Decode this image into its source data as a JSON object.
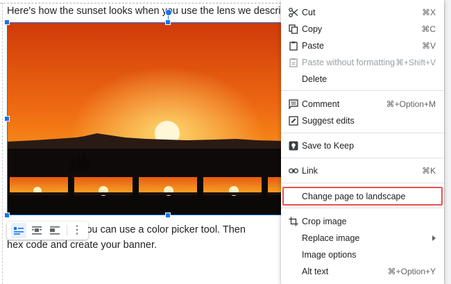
{
  "document": {
    "paragraph_top": "Here's how the sunset looks when you use the lens we described:",
    "paragraph_bottom_line1": "To                 of the image, you can use a color picker tool. Then",
    "paragraph_bottom_line2": "hex code and create your banner."
  },
  "image_toolbar": {
    "buttons": [
      {
        "name": "inline",
        "icon": "wrap-inline-icon",
        "active": true
      },
      {
        "name": "wrap-text",
        "icon": "wrap-text-icon",
        "active": false
      },
      {
        "name": "break-text",
        "icon": "break-text-icon",
        "active": false
      }
    ],
    "more_label": "⋮"
  },
  "context_menu": {
    "items": [
      {
        "label": "Cut",
        "shortcut": "⌘X",
        "icon": "scissors-icon"
      },
      {
        "label": "Copy",
        "shortcut": "⌘C",
        "icon": "copy-icon"
      },
      {
        "label": "Paste",
        "shortcut": "⌘V",
        "icon": "clipboard-icon"
      },
      {
        "label": "Paste without formatting",
        "shortcut": "⌘+Shift+V",
        "icon": "clipboard-text-icon",
        "disabled": true
      },
      {
        "label": "Delete",
        "shortcut": ""
      },
      {
        "label": "Comment",
        "shortcut": "⌘+Option+M",
        "icon": "comment-icon"
      },
      {
        "label": "Suggest edits",
        "shortcut": "",
        "icon": "suggest-edits-icon"
      },
      {
        "label": "Save to Keep",
        "shortcut": "",
        "icon": "keep-icon"
      },
      {
        "label": "Link",
        "shortcut": "⌘K",
        "icon": "link-icon"
      },
      {
        "label": "Change page to landscape",
        "shortcut": ""
      },
      {
        "label": "Crop image",
        "shortcut": "",
        "icon": "crop-icon"
      },
      {
        "label": "Replace image",
        "shortcut": "",
        "submenu": true
      },
      {
        "label": "Image options",
        "shortcut": ""
      },
      {
        "label": "Alt text",
        "shortcut": "⌘+Option+Y"
      }
    ]
  },
  "colors": {
    "selection": "#1a73e8",
    "highlight_box": "#e8514e",
    "sky_top": "#e0480f",
    "sky_bottom": "#f9a21a"
  }
}
